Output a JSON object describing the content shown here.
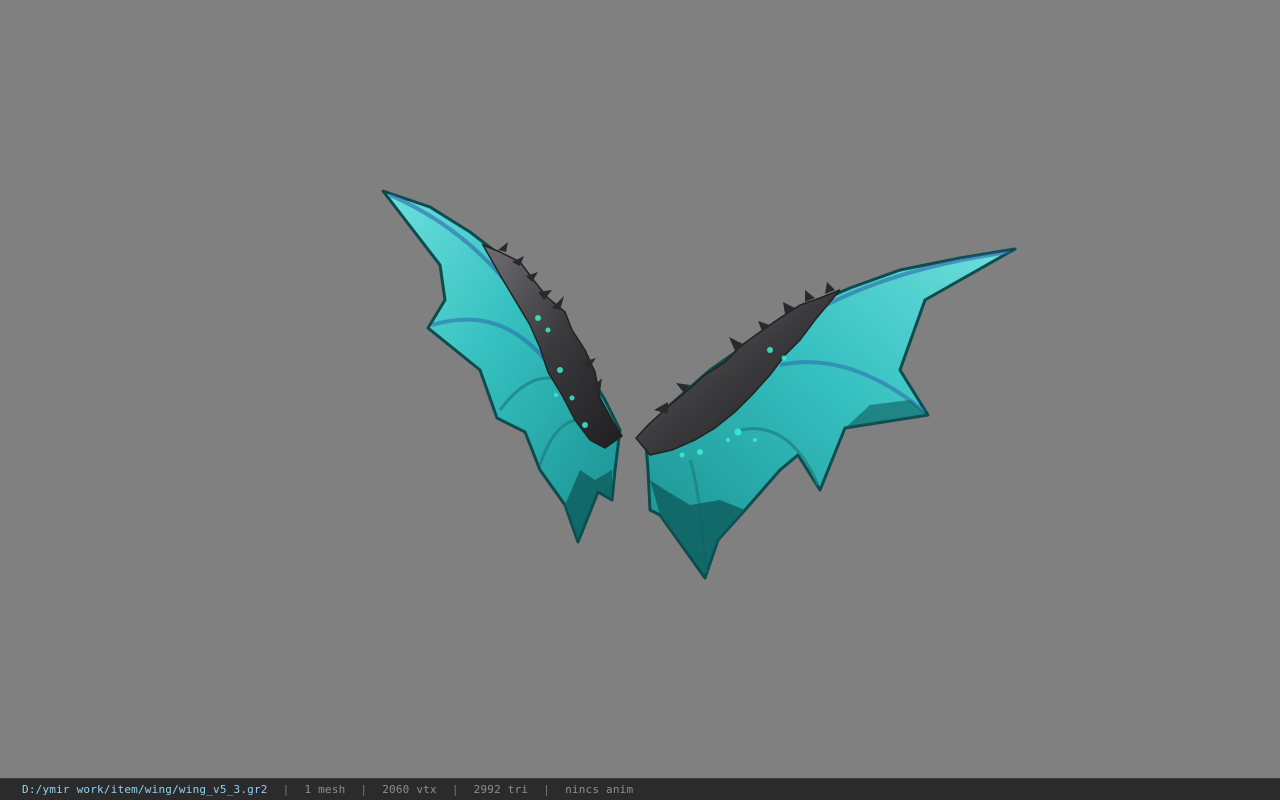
{
  "viewport": {
    "background_color": "#808080",
    "model": {
      "icon": "wing-model",
      "colors": {
        "membrane_light": "#5fd7d6",
        "membrane_mid": "#2bb2b3",
        "membrane_dark": "#0f6a6c",
        "vein": "#2b5fa8",
        "bone": "#3c3c3e",
        "bone_highlight": "#8a8a90",
        "spots": "#3cf0d0"
      }
    }
  },
  "statusbar": {
    "file_path": "D:/ymir work/item/wing/wing_v5_3.gr2",
    "separator": "|",
    "mesh_count": "1 mesh",
    "vertex_count": "2060 vtx",
    "triangle_count": "2992 tri",
    "anim": "nincs anim",
    "colors": {
      "background": "#2b2b2b",
      "path_text": "#8fd3f0",
      "text": "#8f8f8f"
    }
  }
}
